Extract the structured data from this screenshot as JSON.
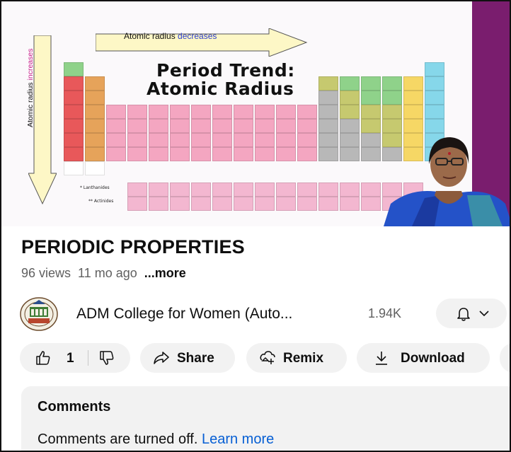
{
  "video": {
    "slide_title_line1": "Period Trend:",
    "slide_title_line2": "Atomic Radius",
    "arrow_top_prefix": "Atomic radius ",
    "arrow_top_emph": "decreases",
    "arrow_left_prefix": "Atomic radius ",
    "arrow_left_emph": "increases",
    "lanthanides_label": "* Lanthanides",
    "actinides_label": "** Actinides",
    "colors": {
      "alkali": "#e8585a",
      "alkaline": "#e6a35a",
      "transition": "#f4a6c1",
      "poor_metal": "#b8b8b8",
      "metalloid": "#c6c96f",
      "nonmetal": "#8fd28a",
      "halogen": "#f6d765",
      "noble": "#86d7ea",
      "hydrogen": "#8fd28a",
      "lanthanide": "#f3b7d0",
      "accent_purple": "#7a1d6e"
    }
  },
  "info": {
    "title": "PERIODIC PROPERTIES",
    "views": "96 views",
    "age": "11 mo ago",
    "more": "...more"
  },
  "channel": {
    "name": "ADM College for Women (Auto...",
    "subscribers": "1.94K"
  },
  "actions": {
    "like_count": "1",
    "share": "Share",
    "remix": "Remix",
    "download": "Download"
  },
  "comments": {
    "heading": "Comments",
    "text": "Comments are turned off.",
    "link": "Learn more"
  }
}
